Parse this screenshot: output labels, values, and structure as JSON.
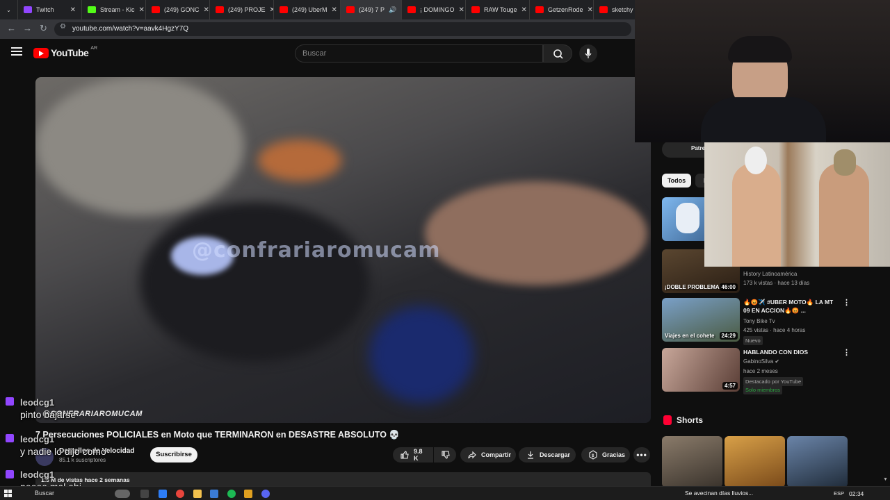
{
  "browser": {
    "tabs": [
      {
        "label": "Twitch",
        "icon": "twitch-icon",
        "color": "#9146ff"
      },
      {
        "label": "Stream - Kic",
        "icon": "kick-icon",
        "color": "#53fc18"
      },
      {
        "label": "(249) GONC",
        "icon": "youtube-icon",
        "color": "#ff0000"
      },
      {
        "label": "(249) PROJE",
        "icon": "youtube-icon",
        "color": "#ff0000"
      },
      {
        "label": "(249) UberM",
        "icon": "youtube-icon",
        "color": "#ff0000"
      },
      {
        "label": "(249) 7 P",
        "icon": "youtube-icon",
        "color": "#ff0000",
        "active": true
      },
      {
        "label": "¡ DOMINGO",
        "icon": "youtube-icon",
        "color": "#ff0000"
      },
      {
        "label": "RAW Touge",
        "icon": "youtube-icon",
        "color": "#ff0000"
      },
      {
        "label": "GetzenRode",
        "icon": "youtube-icon",
        "color": "#ff0000"
      },
      {
        "label": "sketchy sp",
        "icon": "youtube-icon",
        "color": "#ff0000"
      }
    ],
    "url": "youtube.com/watch?v=aavk4HgzY7Q"
  },
  "youtube": {
    "logo_text": "YouTube",
    "country_code": "AR",
    "search_placeholder": "Buscar"
  },
  "video": {
    "watermark": "@confrariaromucam",
    "watermark_bottom": "@CONFRARIAROMUCAM",
    "title": "7 Persecuciones POLICIALES en Moto que TERMINARON en DESASTRE ABSOLUTO 💀",
    "channel_name": "Destellos de Velocidad",
    "subscribers": "85.1 k suscriptores",
    "subscribe_label": "Suscribirse",
    "likes": "9.8 K",
    "share_label": "Compartir",
    "download_label": "Descargar",
    "thanks_label": "Gracias",
    "views_line": "1.3 M de vistas  hace 2 semanas"
  },
  "chat": [
    {
      "user": "leodcg1",
      "message": "pinto bajarse"
    },
    {
      "user": "leodcg1",
      "message": "y nadie lo dijo como"
    },
    {
      "user": "leodcg1",
      "message": "noooo mal ahi"
    }
  ],
  "sidebar": {
    "patreon_chip": "Patreon",
    "chips": [
      "Todos",
      "P"
    ],
    "recommendations": [
      {
        "thumb_text": "",
        "duration": "",
        "title": "",
        "meta": []
      },
      {
        "thumb_text": "¡DOBLE PROBLEMA!",
        "duration": "46:00",
        "title": "",
        "meta": [
          "History Latinoamérica",
          "173 k vistas · hace 13 días"
        ]
      },
      {
        "thumb_text": "Viajes en el cohete",
        "duration": "24:29",
        "title": "🔥😡✈️ #UBER MOTO🔥 LA MT 09 EN ACCION🔥😡 ...",
        "meta": [
          "Tony Bike Tv",
          "425 vistas · hace 4 horas"
        ],
        "badge": "Nuevo"
      },
      {
        "thumb_text": "",
        "duration": "4:57",
        "title": "HABLANDO CON DIOS",
        "meta": [
          "GabinoSilva ✔",
          "hace 2 meses"
        ],
        "badge": "Destacado por YouTube",
        "badge2": "Solo miembros"
      }
    ],
    "shorts_label": "Shorts"
  },
  "taskbar": {
    "search": "Buscar",
    "weather": "Se avecinan días lluvios...",
    "lang": "ESP",
    "clock": "02:34"
  }
}
